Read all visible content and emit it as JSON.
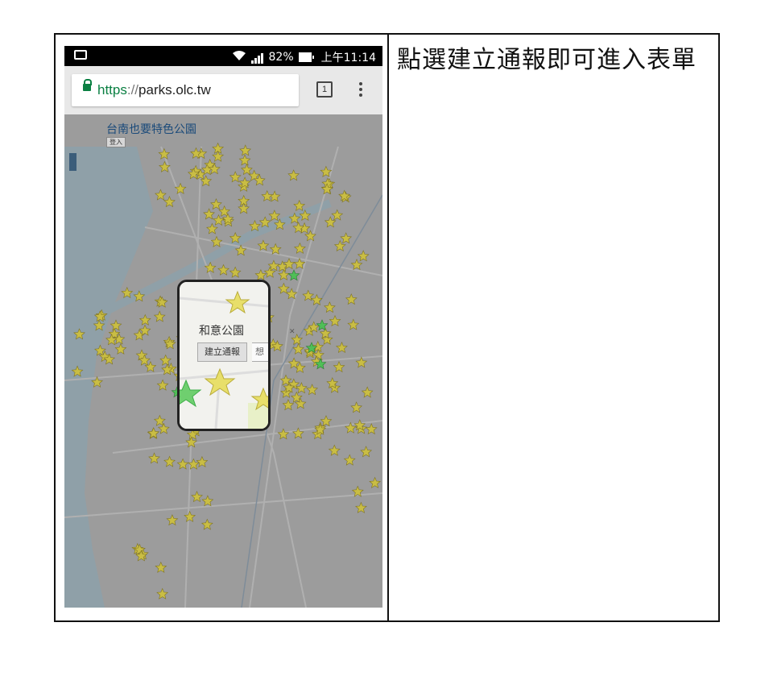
{
  "status_bar": {
    "wifi_icon": "wifi-icon",
    "signal_icon": "signal-icon",
    "battery_percent": "82%",
    "time": "上午11:14"
  },
  "browser": {
    "url_scheme": "https",
    "url_separator": "://",
    "url_host": "parks.olc.tw",
    "tab_count": "1"
  },
  "map": {
    "title": "台南也要特色公園",
    "login_label": "登入",
    "popup": {
      "park_name": "和意公園",
      "create_report_label": "建立通報",
      "second_button_partial": "想"
    }
  },
  "instruction": {
    "text": "點選建立通報即可進入表單"
  },
  "colors": {
    "star_yellow": "#b9ac3a",
    "star_green": "#3fae49",
    "map_overlay": "#9c9c9c",
    "water": "#8fa9b5"
  }
}
